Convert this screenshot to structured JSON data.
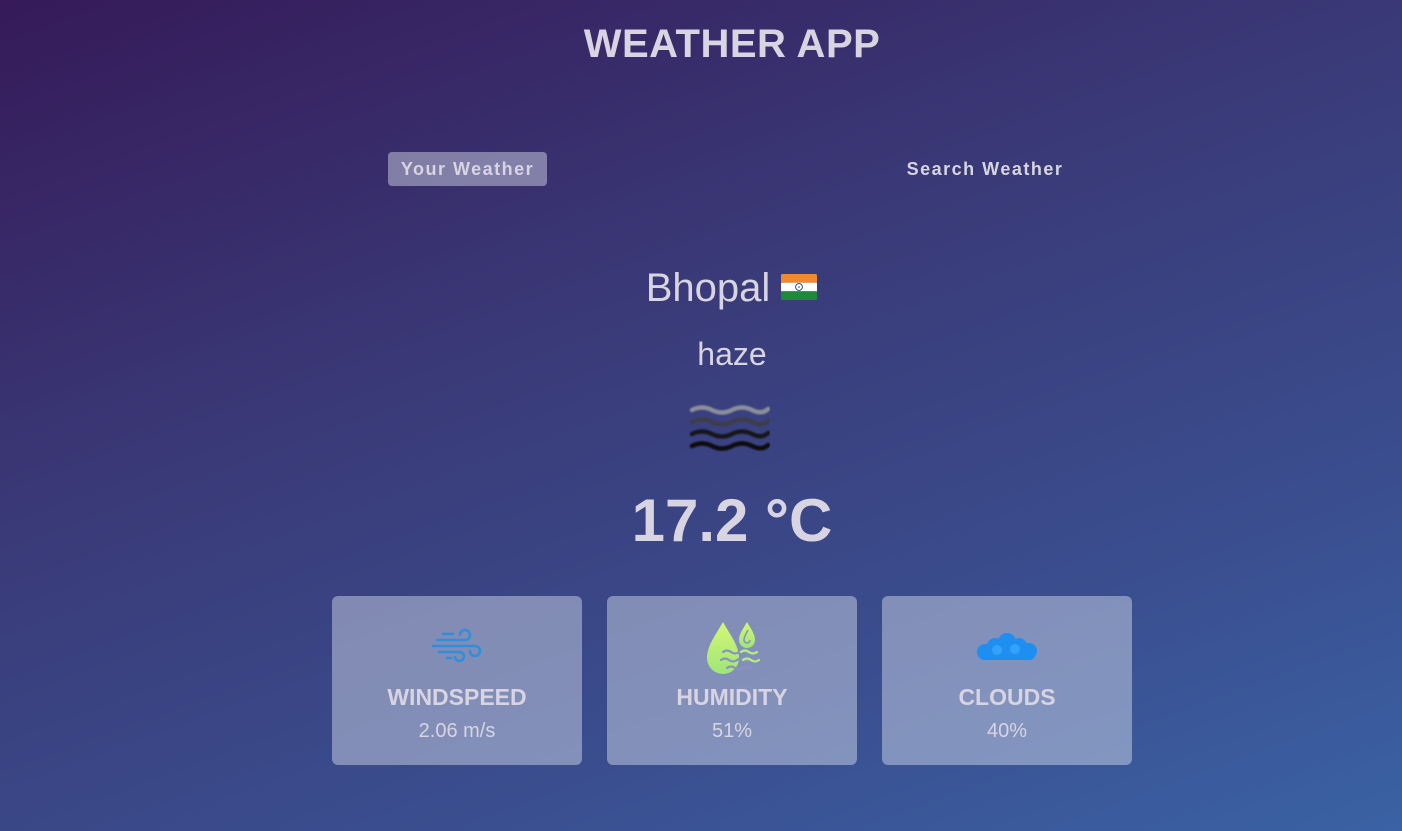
{
  "header": {
    "title": "WEATHER APP"
  },
  "tabs": [
    {
      "label": "Your Weather",
      "active": true
    },
    {
      "label": "Search Weather",
      "active": false
    }
  ],
  "weather": {
    "city": "Bhopal",
    "country_flag": "india-flag-icon",
    "description": "haze",
    "condition_icon": "haze-icon",
    "temperature": "17.2 °C"
  },
  "stats": [
    {
      "icon": "wind-icon",
      "label": "WINDSPEED",
      "value": "2.06 m/s"
    },
    {
      "icon": "humidity-icon",
      "label": "HUMIDITY",
      "value": "51%"
    },
    {
      "icon": "clouds-icon",
      "label": "CLOUDS",
      "value": "40%"
    }
  ],
  "colors": {
    "background_start": "#361a59",
    "background_end": "#3a62a4",
    "text": "#d8d4e2",
    "card": "rgba(219,226,239,0.45)",
    "wind_icon": "#2f8fd9",
    "humidity_icon": "#b6f07a",
    "clouds_icon": "#1e8ef0"
  }
}
